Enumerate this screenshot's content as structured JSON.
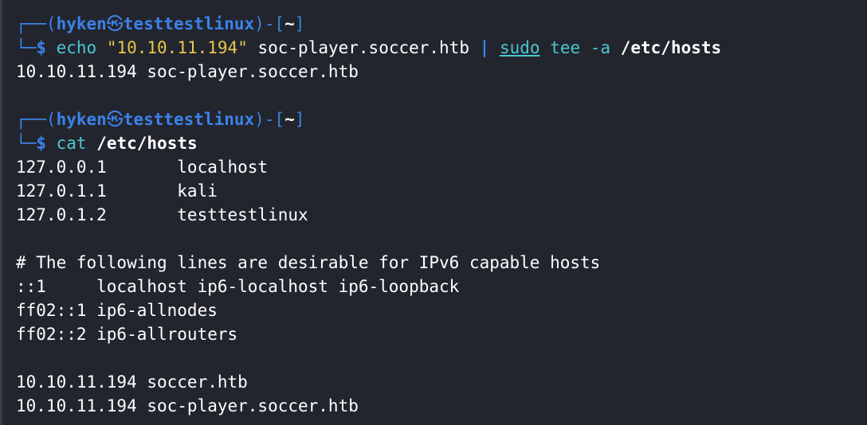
{
  "prompt": {
    "user": "hyken",
    "skull": "㉿",
    "host": "testtestlinux",
    "cwd": "~"
  },
  "commands": [
    {
      "program": "echo",
      "string": "\"10.10.11.194\"",
      "rest": " soc-player.soccer.htb ",
      "pipe": "|",
      "sudo": "sudo",
      "tee": "tee",
      "flag": "-a",
      "target": "/etc/hosts",
      "output": [
        "10.10.11.194 soc-player.soccer.htb"
      ]
    },
    {
      "program": "cat",
      "target": "/etc/hosts",
      "output": [
        "127.0.0.1       localhost",
        "127.0.1.1       kali",
        "127.0.1.2       testtestlinux",
        "",
        "# The following lines are desirable for IPv6 capable hosts",
        "::1     localhost ip6-localhost ip6-loopback",
        "ff02::1 ip6-allnodes",
        "ff02::2 ip6-allrouters",
        "",
        "10.10.11.194 soccer.htb",
        "10.10.11.194 soc-player.soccer.htb"
      ]
    }
  ]
}
